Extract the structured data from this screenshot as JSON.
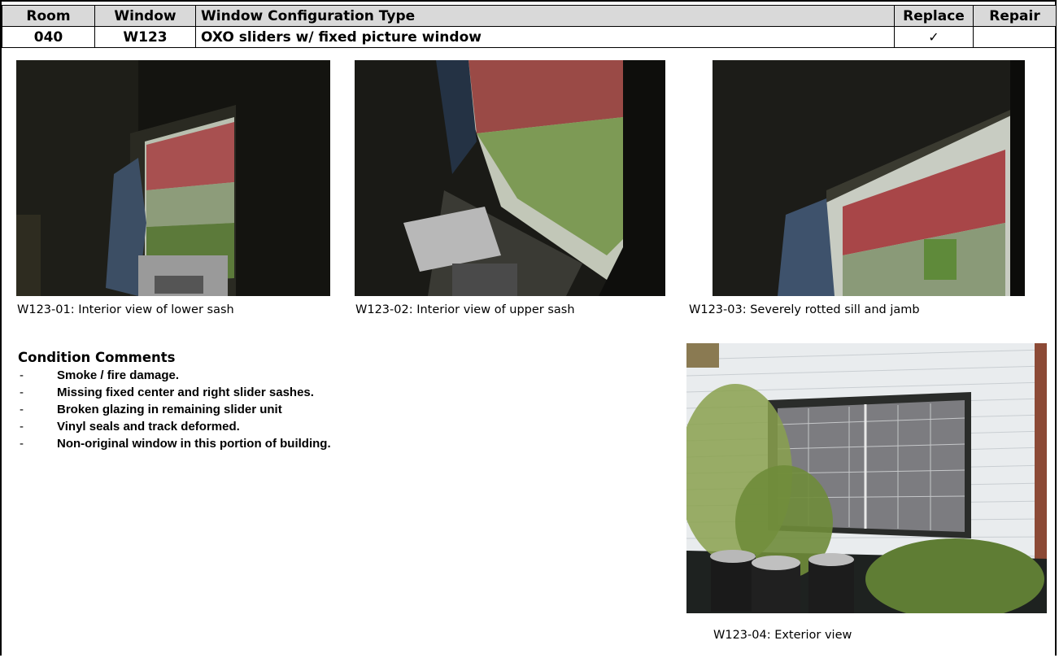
{
  "header": {
    "columns": [
      "Room",
      "Window",
      "Window Configuration Type",
      "Replace",
      "Repair"
    ],
    "row": {
      "room": "040",
      "window": "W123",
      "configuration": "OXO sliders w/ fixed picture window",
      "replace": "✓",
      "repair": ""
    }
  },
  "photos": [
    {
      "caption": "W123-01:  Interior view of lower sash"
    },
    {
      "caption": "W123-02:  Interior view of upper sash"
    },
    {
      "caption": "W123-03:  Severely rotted sill and jamb"
    },
    {
      "caption": "W123-04:  Exterior view"
    }
  ],
  "comments": {
    "title": "Condition Comments",
    "items": [
      "Smoke / fire damage.",
      "Missing fixed center and right slider sashes.",
      "Broken glazing in remaining slider unit",
      "Vinyl seals and track deformed.",
      "Non-original window in this portion of building."
    ]
  }
}
